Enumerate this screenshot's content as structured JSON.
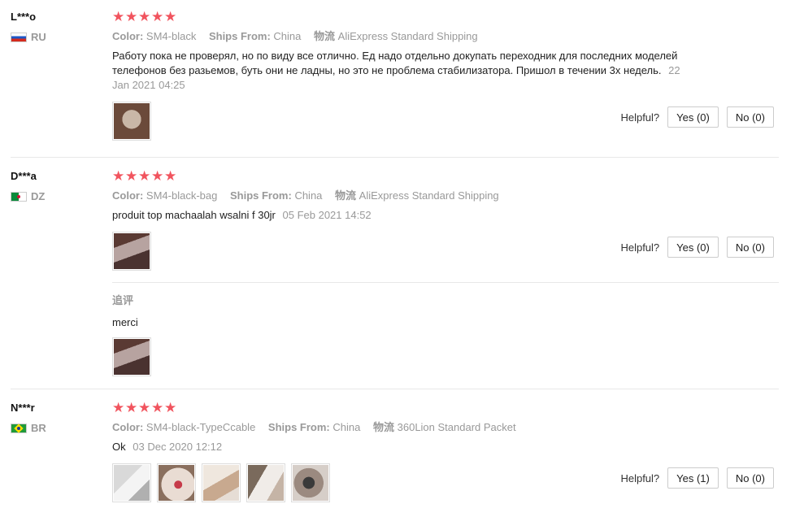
{
  "reviews": [
    {
      "user": "L***o",
      "country": "RU",
      "stars": [
        "★",
        "★",
        "★",
        "★",
        "★"
      ],
      "color_label": "Color:",
      "color_value": "SM4-black",
      "ships_label": "Ships From:",
      "ships_value": "China",
      "logistics_label": "物流",
      "logistics_value": "AliExpress Standard Shipping",
      "text": "Работу пока не проверял, но по виду все отлично. Ед надо отдельно докупать переходник для последних моделей телефонов без разьемов, буть они не ладны, но это не проблема стабилизатора. Пришол в течении 3х недель.",
      "date": "22 Jan 2021 04:25",
      "helpful_label": "Helpful?",
      "yes_label": "Yes (0)",
      "no_label": "No (0)"
    },
    {
      "user": "D***a",
      "country": "DZ",
      "stars": [
        "★",
        "★",
        "★",
        "★",
        "★"
      ],
      "color_label": "Color:",
      "color_value": "SM4-black-bag",
      "ships_label": "Ships From:",
      "ships_value": "China",
      "logistics_label": "物流",
      "logistics_value": "AliExpress Standard Shipping",
      "text": "produit top machaalah wsalni f 30jr",
      "date": "05 Feb 2021 14:52",
      "helpful_label": "Helpful?",
      "yes_label": "Yes (0)",
      "no_label": "No (0)",
      "followup_label": "追评",
      "followup_text": "merci"
    },
    {
      "user": "N***r",
      "country": "BR",
      "stars": [
        "★",
        "★",
        "★",
        "★",
        "★"
      ],
      "color_label": "Color:",
      "color_value": "SM4-black-TypeCcable",
      "ships_label": "Ships From:",
      "ships_value": "China",
      "logistics_label": "物流",
      "logistics_value": "360Lion Standard Packet",
      "text": "Ok",
      "date": "03 Dec 2020 12:12",
      "helpful_label": "Helpful?",
      "yes_label": "Yes (1)",
      "no_label": "No (0)"
    }
  ],
  "colors": {
    "star": "#f1545e",
    "muted": "#999999",
    "border": "#cccccc"
  }
}
